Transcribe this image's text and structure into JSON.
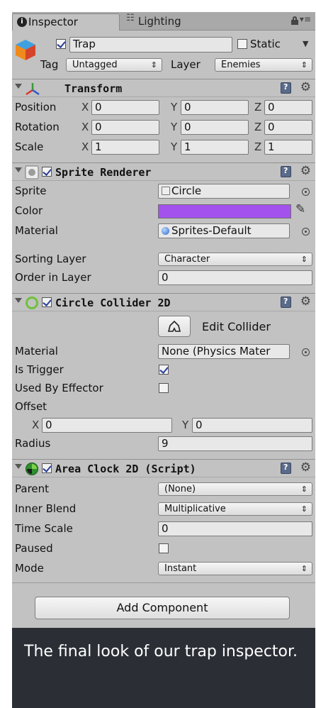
{
  "tabs": [
    {
      "label": "Inspector",
      "icon": "info-icon"
    },
    {
      "label": "Lighting",
      "icon": "lighting-icon"
    }
  ],
  "gameobject": {
    "active": true,
    "name": "Trap",
    "static_label": "Static",
    "static_checked": false,
    "tag_label": "Tag",
    "tag_value": "Untagged",
    "layer_label": "Layer",
    "layer_value": "Enemies"
  },
  "transform": {
    "title": "Transform",
    "rows": [
      {
        "label": "Position",
        "x": "0",
        "y": "0",
        "z": "0"
      },
      {
        "label": "Rotation",
        "x": "0",
        "y": "0",
        "z": "0"
      },
      {
        "label": "Scale",
        "x": "1",
        "y": "1",
        "z": "1"
      }
    ],
    "axes": {
      "x": "X",
      "y": "Y",
      "z": "Z"
    }
  },
  "sprite_renderer": {
    "title": "Sprite Renderer",
    "enabled": true,
    "sprite_label": "Sprite",
    "sprite_value": "Circle",
    "color_label": "Color",
    "color_value": "#a452ee",
    "material_label": "Material",
    "material_value": "Sprites-Default",
    "sorting_layer_label": "Sorting Layer",
    "sorting_layer_value": "Character",
    "order_label": "Order in Layer",
    "order_value": "0"
  },
  "circle_collider": {
    "title": "Circle Collider 2D",
    "enabled": true,
    "edit_button": "Edit Collider",
    "material_label": "Material",
    "material_value": "None (Physics Mater",
    "is_trigger_label": "Is Trigger",
    "is_trigger": true,
    "used_by_effector_label": "Used By Effector",
    "used_by_effector": false,
    "offset_label": "Offset",
    "offset_x": "0",
    "offset_y": "0",
    "radius_label": "Radius",
    "radius_value": "9"
  },
  "area_clock": {
    "title": "Area Clock 2D (Script)",
    "enabled": true,
    "parent_label": "Parent",
    "parent_value": "(None)",
    "inner_blend_label": "Inner Blend",
    "inner_blend_value": "Multiplicative",
    "time_scale_label": "Time Scale",
    "time_scale_value": "0",
    "paused_label": "Paused",
    "paused": false,
    "mode_label": "Mode",
    "mode_value": "Instant"
  },
  "add_component_label": "Add Component",
  "caption": "The final look of our trap inspector."
}
